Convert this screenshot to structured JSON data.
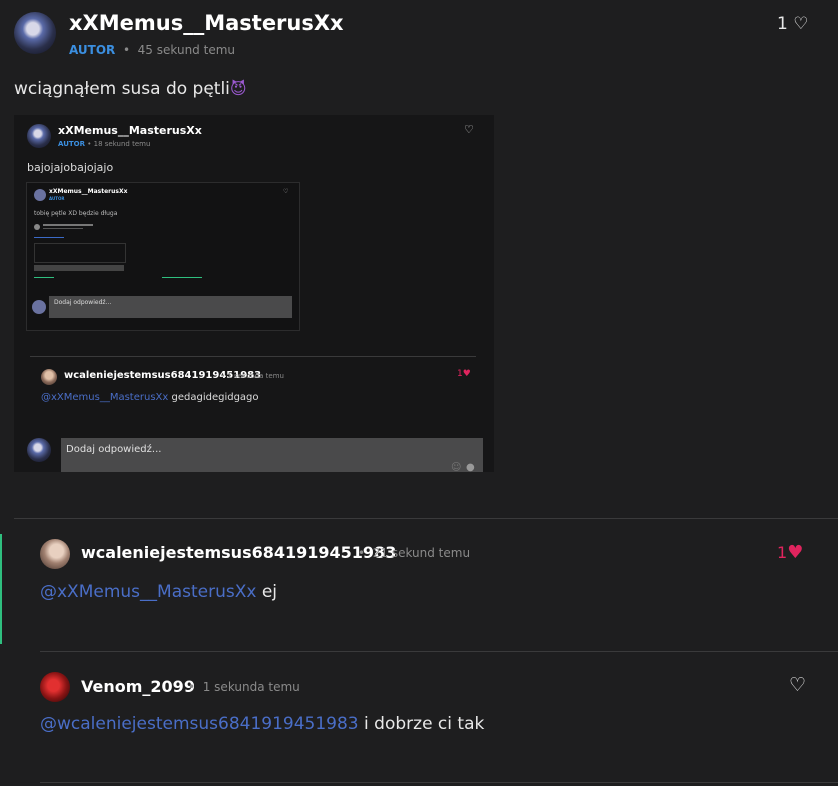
{
  "post": {
    "author": "xXMemus__MasterusXx",
    "badge": "AUTOR",
    "time": "45 sekund temu",
    "likes": "1",
    "text": "wciągnąłem susa do pętli",
    "emoji": "😈"
  },
  "embedded": {
    "author": "xXMemus__MasterusXx",
    "badge": "AUTOR",
    "time": "18 sekund temu",
    "text": "bajojajobajojajo",
    "nested": {
      "author": "xXMemus__MasterusXx",
      "badge": "AUTOR",
      "text": "tobię pętle XD będzie długa",
      "reply_placeholder": "Dodaj odpowiedź..."
    },
    "comment": {
      "author": "wcaleniejestemsus6841919451983",
      "time": "1 sekunda temu",
      "likes": "1",
      "mention": "@xXMemus__MasterusXx",
      "text": "gedagidegidgago"
    },
    "reply_placeholder": "Dodaj odpowiedź..."
  },
  "comments": [
    {
      "author": "wcaleniejestemsus6841919451983",
      "time": "21 sekund temu",
      "likes": "1",
      "mention": "@xXMemus__MasterusXx",
      "text": "ej"
    },
    {
      "author": "Venom_2099",
      "time": "1 sekunda temu",
      "mention": "@wcaleniejestemsus6841919451983",
      "text": "i dobrze ci tak"
    }
  ],
  "colors": {
    "background": "#1e1e1f",
    "badge": "#3b8fe0",
    "mention": "#4a6ec7",
    "like_active": "#e0245e",
    "thread_line": "#2fbf7f"
  }
}
